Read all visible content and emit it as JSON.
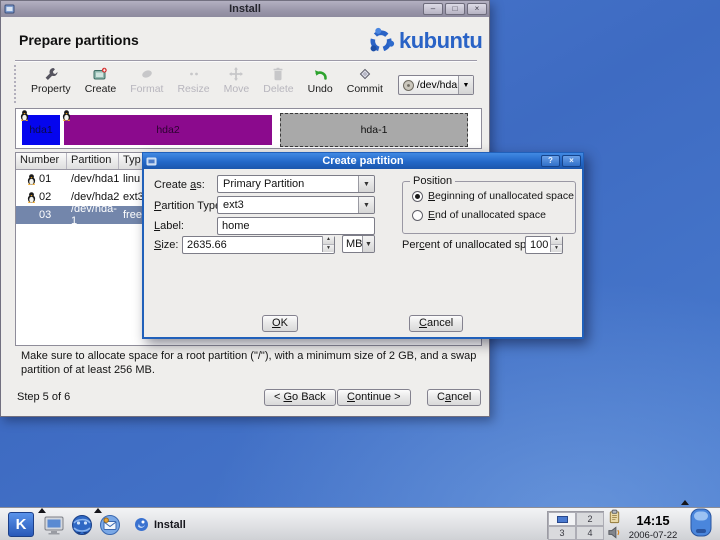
{
  "main_window": {
    "title": "Install",
    "heading": "Prepare partitions",
    "logo_text": "kubuntu",
    "toolbar": {
      "items": [
        {
          "label": "Property",
          "enabled": true
        },
        {
          "label": "Create",
          "enabled": true
        },
        {
          "label": "Format",
          "enabled": false
        },
        {
          "label": "Resize",
          "enabled": false
        },
        {
          "label": "Move",
          "enabled": false
        },
        {
          "label": "Delete",
          "enabled": false
        },
        {
          "label": "Undo",
          "enabled": true
        },
        {
          "label": "Commit",
          "enabled": true
        }
      ],
      "device_combo_value": "/dev/hda"
    },
    "partition_bar": {
      "blocks": [
        {
          "label": "hda1",
          "color": "#0505ee",
          "selected": false
        },
        {
          "label": "hda2",
          "color": "#8b0a8d",
          "selected": false
        },
        {
          "label": "hda-1",
          "color": "#a9a9a9",
          "selected": true
        }
      ]
    },
    "table": {
      "columns": [
        "Number",
        "Partition",
        "Typ"
      ],
      "rows": [
        {
          "number": "01",
          "partition": "/dev/hda1",
          "type": "linu",
          "selected": false
        },
        {
          "number": "02",
          "partition": "/dev/hda2",
          "type": "ext3",
          "selected": false
        },
        {
          "number": "03",
          "partition": "/dev/hda-1",
          "type": "free",
          "selected": true
        }
      ]
    },
    "note": "Make sure to allocate space for a root partition (\"/\"), with a minimum size of 2 GB, and a swap partition of at least 256 MB.",
    "step_label": "Step 5 of 6",
    "buttons": {
      "go_back": "< Go Back",
      "continue": "Continue >",
      "cancel": "Cancel"
    }
  },
  "dialog": {
    "title": "Create partition",
    "create_as_label": "Create as:",
    "create_as_value": "Primary Partition",
    "partition_type_label": "Partition Type:",
    "partition_type_value": "ext3",
    "label_label": "Label:",
    "label_value": "home",
    "size_label": "Size:",
    "size_value": "2635.66",
    "size_unit": "MB",
    "position_group_label": "Position",
    "position_options": [
      {
        "label": "Beginning of unallocated space",
        "selected": true
      },
      {
        "label": "End of unallocated space",
        "selected": false
      }
    ],
    "percent_label": "Percent of unallocated space:",
    "percent_value": "100",
    "ok_label": "OK",
    "cancel_label": "Cancel"
  },
  "taskbar": {
    "task_label": "Install",
    "pager_cells": [
      "",
      "2",
      "3",
      "4"
    ],
    "clock_time": "14:15",
    "clock_date": "2006-07-22"
  },
  "colors": {
    "desktop_blue": "#4273c8",
    "dialog_titlebar_blue": "#2a6fd2",
    "selection_blue": "#7386ab",
    "kubuntu_blue": "#2a63c6"
  }
}
